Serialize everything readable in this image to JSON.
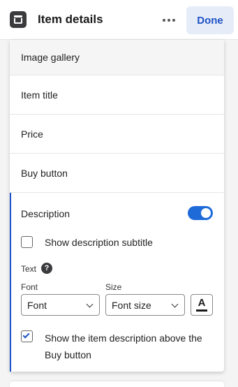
{
  "header": {
    "title": "Item details",
    "more_icon": "more-horizontal-icon",
    "done_label": "Done"
  },
  "sections": [
    {
      "label": "Image gallery"
    },
    {
      "label": "Item title"
    },
    {
      "label": "Price"
    },
    {
      "label": "Buy button"
    }
  ],
  "description": {
    "label": "Description",
    "enabled": true,
    "show_subtitle_label": "Show description subtitle",
    "show_subtitle_checked": false,
    "text_label": "Text",
    "help_icon": "?",
    "font_label": "Font",
    "font_value": "Font",
    "size_label": "Size",
    "size_value": "Font size",
    "color_glyph": "A",
    "above_buy_label": "Show the item description above the Buy button",
    "above_buy_checked": true
  },
  "colors": {
    "accent": "#1e52c7",
    "toggle_on": "#1e6ad9",
    "done_bg": "#e6ecf8"
  }
}
